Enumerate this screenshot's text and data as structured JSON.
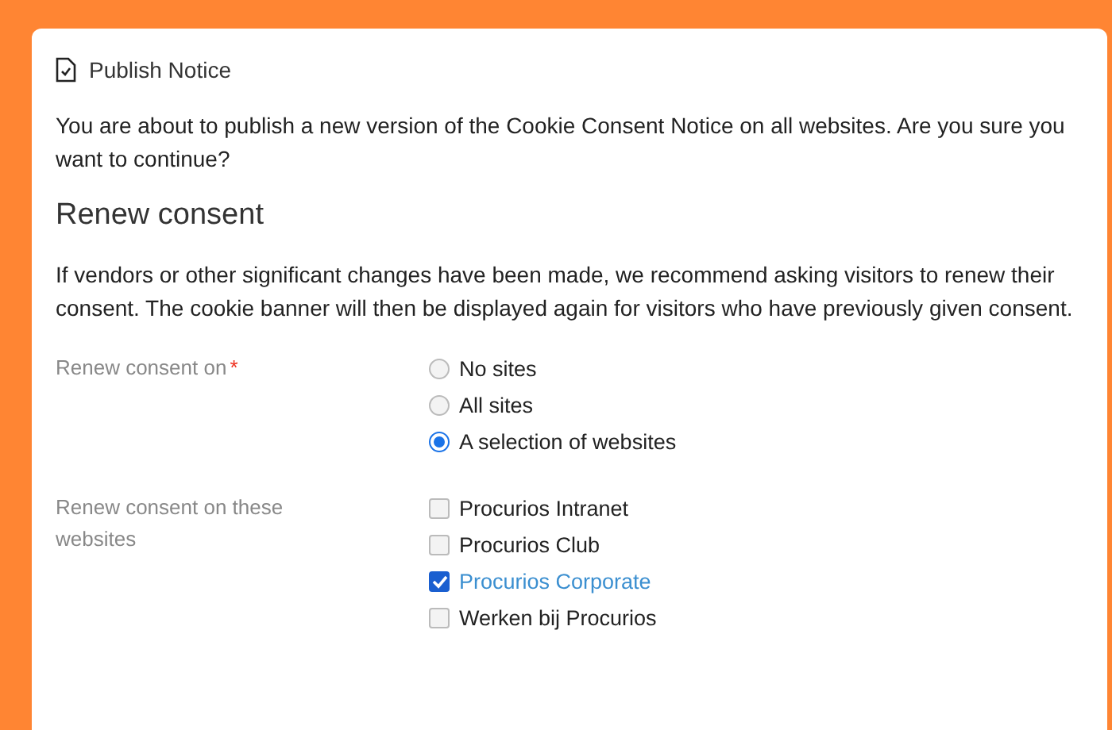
{
  "dialog": {
    "title": "Publish Notice"
  },
  "intro": "You are about to publish a new version of the Cookie Consent Notice on all websites. Are you sure you want to continue?",
  "section": {
    "heading": "Renew consent",
    "description": "If vendors or other significant changes have been made, we recommend asking visitors to renew their consent. The cookie banner will then be displayed again for visitors who have previously given consent."
  },
  "renew_on": {
    "label": "Renew consent on",
    "required_mark": "*",
    "options": [
      {
        "label": "No sites",
        "selected": false
      },
      {
        "label": "All sites",
        "selected": false
      },
      {
        "label": "A selection of websites",
        "selected": true
      }
    ]
  },
  "websites": {
    "label": "Renew consent on these websites",
    "items": [
      {
        "label": "Procurios Intranet",
        "checked": false
      },
      {
        "label": "Procurios Club",
        "checked": false
      },
      {
        "label": "Procurios Corporate",
        "checked": true
      },
      {
        "label": "Werken bij Procurios",
        "checked": false
      }
    ]
  }
}
